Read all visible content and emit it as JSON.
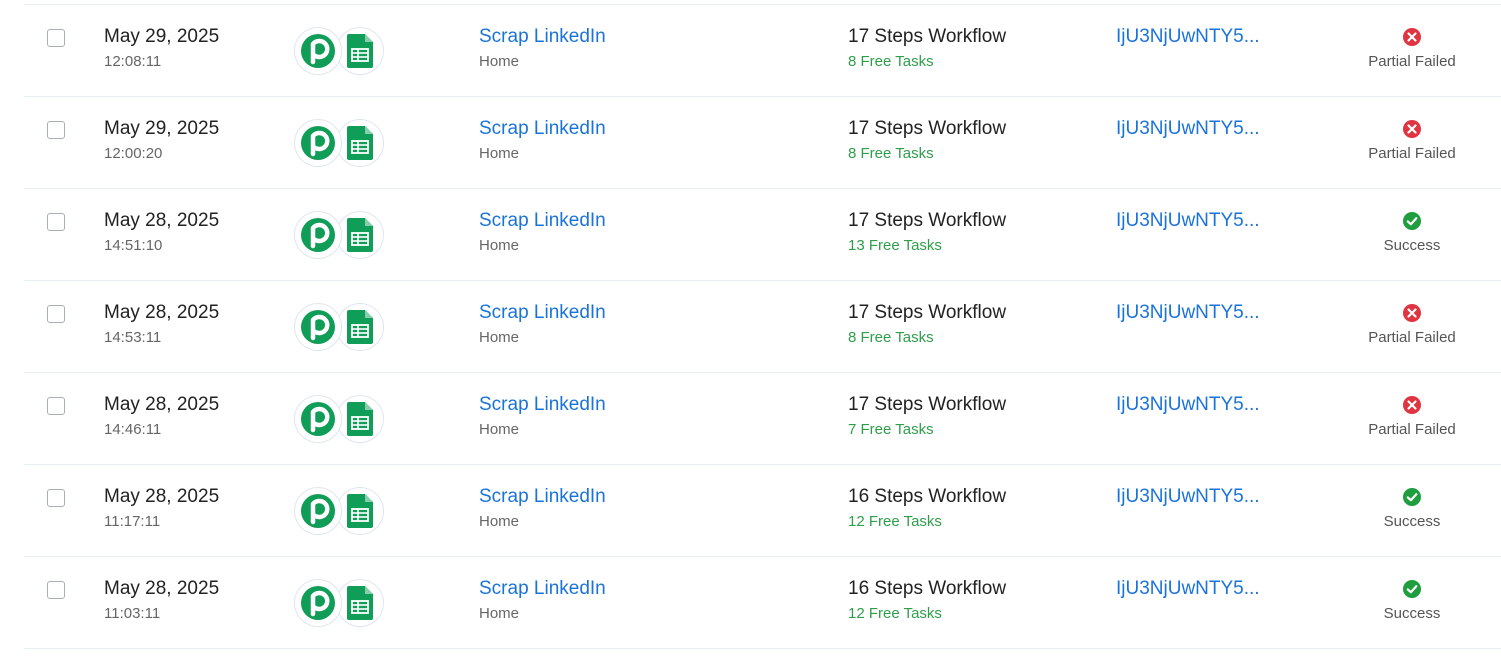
{
  "colors": {
    "link": "#1a73d9",
    "free_tasks": "#2e9e4a",
    "failed": "#e03541",
    "success": "#1e9e3e",
    "brand_green": "#0f9d58"
  },
  "rows": [
    {
      "date": "May 29, 2025",
      "time": "12:08:11",
      "apps": [
        "pabbly-connect-icon",
        "google-sheets-icon"
      ],
      "workflow_name": "Scrap LinkedIn",
      "folder": "Home",
      "steps": "17 Steps Workflow",
      "free_tasks": "8 Free Tasks",
      "task_id": "IjU3NjUwNTY5...",
      "status": "Partial Failed",
      "status_type": "failed"
    },
    {
      "date": "May 29, 2025",
      "time": "12:00:20",
      "apps": [
        "pabbly-connect-icon",
        "google-sheets-icon"
      ],
      "workflow_name": "Scrap LinkedIn",
      "folder": "Home",
      "steps": "17 Steps Workflow",
      "free_tasks": "8 Free Tasks",
      "task_id": "IjU3NjUwNTY5...",
      "status": "Partial Failed",
      "status_type": "failed"
    },
    {
      "date": "May 28, 2025",
      "time": "14:51:10",
      "apps": [
        "pabbly-connect-icon",
        "google-sheets-icon"
      ],
      "workflow_name": "Scrap LinkedIn",
      "folder": "Home",
      "steps": "17 Steps Workflow",
      "free_tasks": "13 Free Tasks",
      "task_id": "IjU3NjUwNTY5...",
      "status": "Success",
      "status_type": "success"
    },
    {
      "date": "May 28, 2025",
      "time": "14:53:11",
      "apps": [
        "pabbly-connect-icon",
        "google-sheets-icon"
      ],
      "workflow_name": "Scrap LinkedIn",
      "folder": "Home",
      "steps": "17 Steps Workflow",
      "free_tasks": "8 Free Tasks",
      "task_id": "IjU3NjUwNTY5...",
      "status": "Partial Failed",
      "status_type": "failed"
    },
    {
      "date": "May 28, 2025",
      "time": "14:46:11",
      "apps": [
        "pabbly-connect-icon",
        "google-sheets-icon"
      ],
      "workflow_name": "Scrap LinkedIn",
      "folder": "Home",
      "steps": "17 Steps Workflow",
      "free_tasks": "7 Free Tasks",
      "task_id": "IjU3NjUwNTY5...",
      "status": "Partial Failed",
      "status_type": "failed"
    },
    {
      "date": "May 28, 2025",
      "time": "11:17:11",
      "apps": [
        "pabbly-connect-icon",
        "google-sheets-icon"
      ],
      "workflow_name": "Scrap LinkedIn",
      "folder": "Home",
      "steps": "16 Steps Workflow",
      "free_tasks": "12 Free Tasks",
      "task_id": "IjU3NjUwNTY5...",
      "status": "Success",
      "status_type": "success"
    },
    {
      "date": "May 28, 2025",
      "time": "11:03:11",
      "apps": [
        "pabbly-connect-icon",
        "google-sheets-icon"
      ],
      "workflow_name": "Scrap LinkedIn",
      "folder": "Home",
      "steps": "16 Steps Workflow",
      "free_tasks": "12 Free Tasks",
      "task_id": "IjU3NjUwNTY5...",
      "status": "Success",
      "status_type": "success"
    }
  ]
}
